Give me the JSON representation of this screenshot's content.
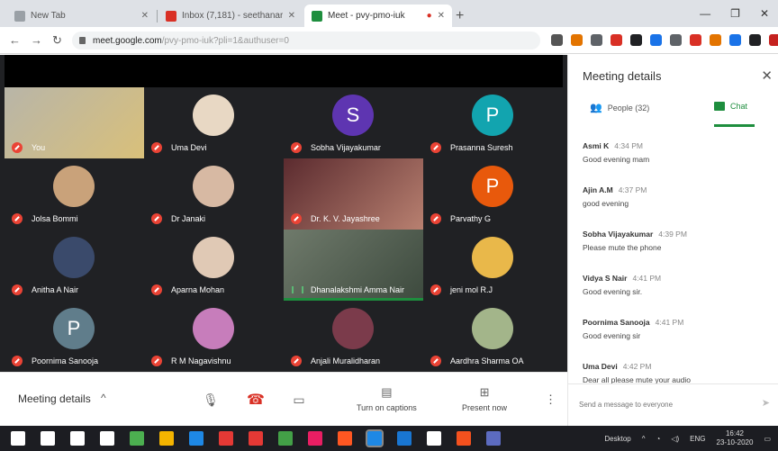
{
  "browser": {
    "tabs": [
      {
        "title": "New Tab",
        "favicon_color": "#9aa0a6"
      },
      {
        "title": "Inbox (7,181) - seethanarsa@gm...",
        "favicon_color": "#d93025"
      },
      {
        "title": "Meet - pvy-pmo-iuk",
        "favicon_color": "#1e8e3e"
      }
    ],
    "new_tab_icon": "+",
    "window_controls": [
      "—",
      "❐",
      "✕"
    ],
    "url_host": "meet.google.com",
    "url_path": "/pvy-pmo-iuk?pli=1&authuser=0",
    "extension_colors": [
      "#555",
      "#e37400",
      "#5f6368",
      "#d93025",
      "#202124",
      "#1a73e8",
      "#5f6368",
      "#d93025",
      "#e37400",
      "#1a73e8",
      "#202124",
      "#c5221f"
    ]
  },
  "meet": {
    "tiles": [
      {
        "name": "You",
        "kind": "video",
        "video_colors": [
          "#b8b5a8",
          "#d9c07a"
        ],
        "mic": "off"
      },
      {
        "name": "Uma Devi",
        "kind": "photo",
        "color": "#e8d8c4",
        "mic": "off"
      },
      {
        "name": "Sobha Vijayakumar",
        "kind": "letter",
        "letter": "S",
        "color": "#5e35b1",
        "mic": "off"
      },
      {
        "name": "Prasanna Suresh",
        "kind": "letter",
        "letter": "P",
        "color": "#12a4af",
        "mic": "off"
      },
      {
        "name": "Jolsa Bommi",
        "kind": "photo",
        "color": "#c9a27a",
        "mic": "off"
      },
      {
        "name": "Dr Janaki",
        "kind": "photo",
        "color": "#d7b9a3",
        "mic": "off"
      },
      {
        "name": "Dr. K. V. Jayashree",
        "kind": "video",
        "video_colors": [
          "#5b2b2f",
          "#b88070"
        ],
        "mic": "off"
      },
      {
        "name": "Parvathy G",
        "kind": "letter",
        "letter": "P",
        "color": "#e8590c",
        "mic": "off"
      },
      {
        "name": "Anitha A Nair",
        "kind": "photo",
        "color": "#3a4a6b",
        "mic": "off"
      },
      {
        "name": "Aparna Mohan",
        "kind": "photo",
        "color": "#e0c9b5",
        "mic": "off"
      },
      {
        "name": "Dhanalakshmi Amma Nair",
        "kind": "video",
        "video_colors": [
          "#6f7a6b",
          "#3d4a3e"
        ],
        "mic": "on"
      },
      {
        "name": "jeni mol R.J",
        "kind": "photo",
        "color": "#e9b84a",
        "mic": "off"
      },
      {
        "name": "Poornima Sanooja",
        "kind": "letter",
        "letter": "P",
        "color": "#607d8b",
        "mic": "off"
      },
      {
        "name": "R M Nagavishnu",
        "kind": "photo",
        "color": "#c77dbb",
        "mic": "off"
      },
      {
        "name": "Anjali Muralidharan",
        "kind": "photo",
        "color": "#7b3b4b",
        "mic": "off"
      },
      {
        "name": "Aardhra Sharma OA",
        "kind": "photo",
        "color": "#a3b58a",
        "mic": "off"
      }
    ]
  },
  "controls": {
    "meeting_details": "Meeting details",
    "chevron": "^",
    "captions_label": "Turn on captions",
    "present_label": "Present now"
  },
  "panel": {
    "title": "Meeting details",
    "people_tab": "People (32)",
    "chat_tab": "Chat",
    "messages": [
      {
        "sender": "Asmi K",
        "time": "4:34 PM",
        "text": "Good evening mam"
      },
      {
        "sender": "Ajin A.M",
        "time": "4:37 PM",
        "text": "good evening"
      },
      {
        "sender": "Sobha Vijayakumar",
        "time": "4:39 PM",
        "text": "Please mute the phone"
      },
      {
        "sender": "Vidya S Nair",
        "time": "4:41 PM",
        "text": "Good evening sir."
      },
      {
        "sender": "Poornima Sanooja",
        "time": "4:41 PM",
        "text": "Good evening sir"
      },
      {
        "sender": "Uma Devi",
        "time": "4:42 PM",
        "text": "Dear all please mute your audio"
      }
    ],
    "chat_placeholder": "Send a message to everyone"
  },
  "taskbar": {
    "icon_colors": [
      "#ffffff",
      "#ffffff",
      "#ffffff",
      "#ffffff",
      "#4caf50",
      "#f4b400",
      "#1e88e5",
      "#e53935",
      "#e53935",
      "#43a047",
      "#e91e63",
      "#ff5722",
      "#1e88e5",
      "#1976d2",
      "#ffffff",
      "#f4511e",
      "#5c6bc0"
    ],
    "desktop_label": "Desktop",
    "lang": "ENG",
    "time": "16:42",
    "date": "23-10-2020"
  }
}
